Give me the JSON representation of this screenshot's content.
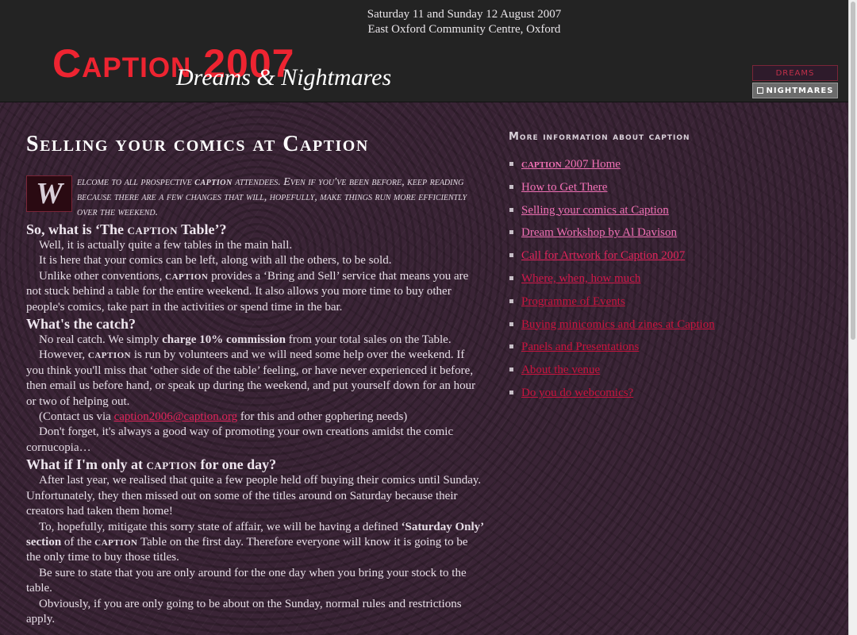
{
  "header": {
    "event_dates": "Saturday 11 and Sunday 12 August 2007",
    "event_venue": "East Oxford Community Centre, Oxford",
    "logo_main": "Caption 2007",
    "logo_sub": "Dreams & Nightmares",
    "theme_switch": {
      "dreams_label": "DREAMS",
      "nightmares_label": "NIGHTMARES"
    }
  },
  "article": {
    "title": "Selling your comics at Caption",
    "intro": {
      "dropcap": "W",
      "lead": "elcome to all prospective",
      "brand": "caption",
      "rest": "attendees. Even if you've been before, keep reading because there are a few changes that will, hopefully, make things run more efficiently over the weekend."
    },
    "sections": [
      {
        "heading_pre": "So, what is ‘The",
        "heading_brand": "caption",
        "heading_post": "Table’?",
        "p1": "Well, it is actually quite a few tables in the main hall.",
        "p2": "It is here that your comics can be left, along with all the others, to be sold.",
        "p3_pre": "Unlike other conventions,",
        "p3_brand": "caption",
        "p3_post": "provides a ‘Bring and Sell’ service that means you are not stuck behind a table for the entire weekend. It also allows you more time to buy other people's comics, take part in the activities or spend time in the bar."
      },
      {
        "heading": "What's the catch?",
        "p1_pre": "No real catch. We simply",
        "p1_bold": "charge 10% commission",
        "p1_post": "from your total sales on the Table.",
        "p2_pre": "However,",
        "p2_brand": "caption",
        "p2_post": "is run by volunteers and we will need some help over the weekend. If you think you'll miss that ‘other side of the table’ feeling, or have never experienced it before, then email us before hand, or speak up during the weekend, and put yourself down for an hour or two of helping out.",
        "p3_pre": "(Contact us via",
        "p3_link": "caption2006@caption.org",
        "p3_post": "for this and other gophering needs)",
        "p4": "Don't forget, it's always a good way of promoting your own creations amidst the comic cornucopia…"
      },
      {
        "heading_pre": "What if I'm only at",
        "heading_brand": "caption",
        "heading_post": "for one day?",
        "p1": "After last year, we realised that quite a few people held off buying their comics until Sunday. Unfortunately, they then missed out on some of the titles around on Saturday because their creators had taken them home!",
        "p2_pre": "To, hopefully, mitigate this sorry state of affair, we will be having a defined",
        "p2_bold": "‘Saturday Only’ section",
        "p2_mid": "of the",
        "p2_brand": "caption",
        "p2_post": "Table on the first day. Therefore everyone will know it is going to be the only time to buy those titles.",
        "p3": "Be sure to state that you are only around for the one day when you bring your stock to the table.",
        "p4": "Obviously, if you are only going to be about on the Sunday, normal rules and restrictions apply."
      }
    ]
  },
  "sidebar": {
    "heading": "More information about caption",
    "items": [
      {
        "brand": "caption",
        "label": "2007 Home"
      },
      {
        "label": "How to Get There"
      },
      {
        "label": "Selling your comics at Caption"
      },
      {
        "label": "Dream Workshop by Al Davison"
      },
      {
        "label": "Call for Artwork for Caption 2007"
      },
      {
        "label": "Where, when, how much"
      },
      {
        "label": "Programme of Events"
      },
      {
        "label": "Buying minicomics and zines at Caption"
      },
      {
        "label": "Panels and Presentations"
      },
      {
        "label": "About the venue"
      },
      {
        "label": "Do you do webcomics?"
      }
    ],
    "link_colors": [
      "#f070b4",
      "#f070b4",
      "#f070b4",
      "#f070b4",
      "#e0245a",
      "#d0184a",
      "#c8143e",
      "#c8143e",
      "#c8143e",
      "#c8143e",
      "#c8143e"
    ]
  },
  "colors": {
    "header_bg": "#232323",
    "page_bg": "#3a2436",
    "logo_red": "#ee2431",
    "link_pink": "#f070b4",
    "link_red": "#c8143e"
  }
}
